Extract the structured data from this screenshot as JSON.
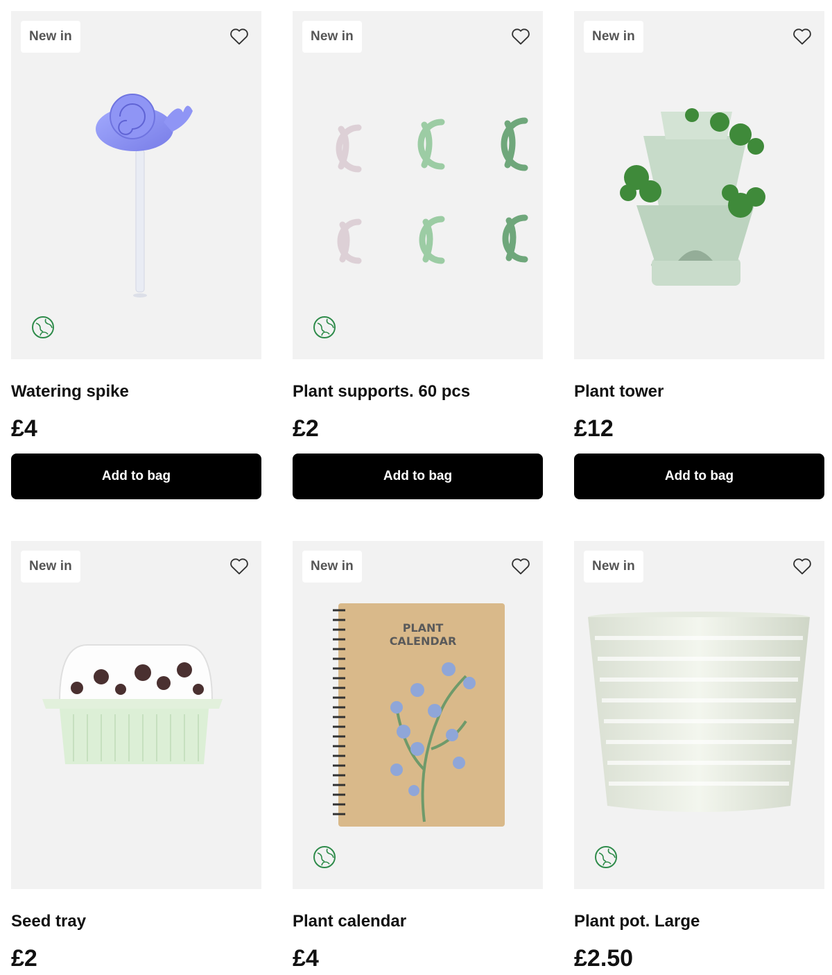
{
  "products": [
    {
      "badge": "New in",
      "title": "Watering spike",
      "price": "£4",
      "button": "Add to bag",
      "eco": true
    },
    {
      "badge": "New in",
      "title": "Plant supports. 60 pcs",
      "price": "£2",
      "button": "Add to bag",
      "eco": true
    },
    {
      "badge": "New in",
      "title": "Plant tower",
      "price": "£12",
      "button": "Add to bag",
      "eco": false
    },
    {
      "badge": "New in",
      "title": "Seed tray",
      "price": "£2",
      "button": "",
      "eco": false
    },
    {
      "badge": "New in",
      "title": "Plant calendar",
      "price": "£4",
      "button": "",
      "eco": true,
      "cover_text_1": "PLANT",
      "cover_text_2": "CALENDAR"
    },
    {
      "badge": "New in",
      "title": "Plant pot. Large",
      "price": "£2.50",
      "button": "",
      "eco": true
    }
  ],
  "icons": {
    "favorite": "heart-outline-icon",
    "eco": "globe-leaf-icon"
  },
  "colors": {
    "button_bg": "#000000",
    "card_bg": "#f2f2f2",
    "eco_green": "#2e8b4a"
  }
}
